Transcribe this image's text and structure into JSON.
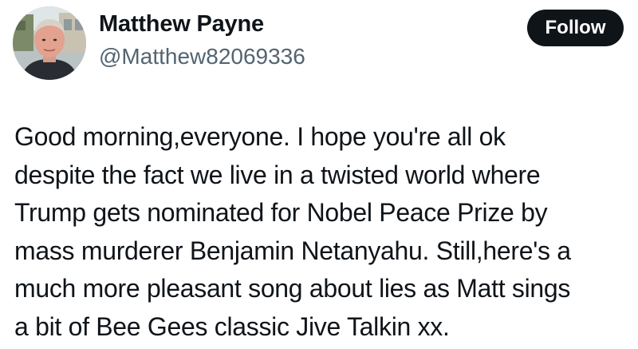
{
  "author": {
    "name": "Matthew Payne",
    "handle": "@Matthew82069336",
    "avatar_icon": "profile-photo"
  },
  "follow_button": {
    "label": "Follow"
  },
  "tweet": {
    "lines": [
      "Good morning,everyone. I hope you're all ok",
      "despite the fact we live in a twisted world where",
      "Trump gets nominated for Nobel Peace Prize by",
      "mass murderer Benjamin Netanyahu. Still,here's a",
      "much more pleasant song about lies as Matt sings",
      "a bit of Bee Gees classic Jive Talkin xx."
    ]
  },
  "colors": {
    "text": "#0f1419",
    "secondary_text": "#536471",
    "button_bg": "#0f1419",
    "button_text": "#ffffff"
  }
}
